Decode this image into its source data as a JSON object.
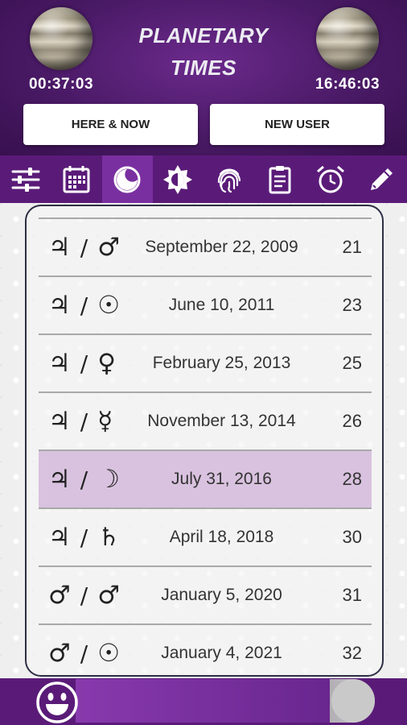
{
  "header": {
    "title_line1": "PLANETARY",
    "title_line2": "TIMES",
    "left_time": "00:37:03",
    "right_time": "16:46:03",
    "here_now_label": "HERE & NOW",
    "new_user_label": "NEW USER"
  },
  "toolbar": {
    "items": [
      {
        "icon": "sliders-icon"
      },
      {
        "icon": "calendar-icon"
      },
      {
        "icon": "moon-phase-icon",
        "active": true
      },
      {
        "icon": "sun-icon"
      },
      {
        "icon": "fingerprint-icon"
      },
      {
        "icon": "clipboard-icon"
      },
      {
        "icon": "alarm-clock-icon"
      },
      {
        "icon": "pencil-icon"
      }
    ]
  },
  "periods": [
    {
      "planet1": "♃",
      "planet2": "♂",
      "date": "September 22, 2009",
      "age": "21"
    },
    {
      "planet1": "♃",
      "planet2": "☉",
      "date": "June 10, 2011",
      "age": "23"
    },
    {
      "planet1": "♃",
      "planet2": "♀",
      "date": "February 25, 2013",
      "age": "25"
    },
    {
      "planet1": "♃",
      "planet2": "☿",
      "date": "November 13, 2014",
      "age": "26"
    },
    {
      "planet1": "♃",
      "planet2": "☽",
      "date": "July 31, 2016",
      "age": "28",
      "selected": true
    },
    {
      "planet1": "♃",
      "planet2": "♄",
      "date": "April 18, 2018",
      "age": "30"
    },
    {
      "planet1": "♂",
      "planet2": "♂",
      "date": "January 5, 2020",
      "age": "31"
    },
    {
      "planet1": "♂",
      "planet2": "☉",
      "date": "January 4, 2021",
      "age": "32"
    }
  ],
  "separator": "/",
  "colors": {
    "header_purple": "#4a1a66",
    "toolbar_purple": "#5a1b78",
    "active_tool": "#7a2fa0",
    "selected_row": "#d9c2df"
  }
}
